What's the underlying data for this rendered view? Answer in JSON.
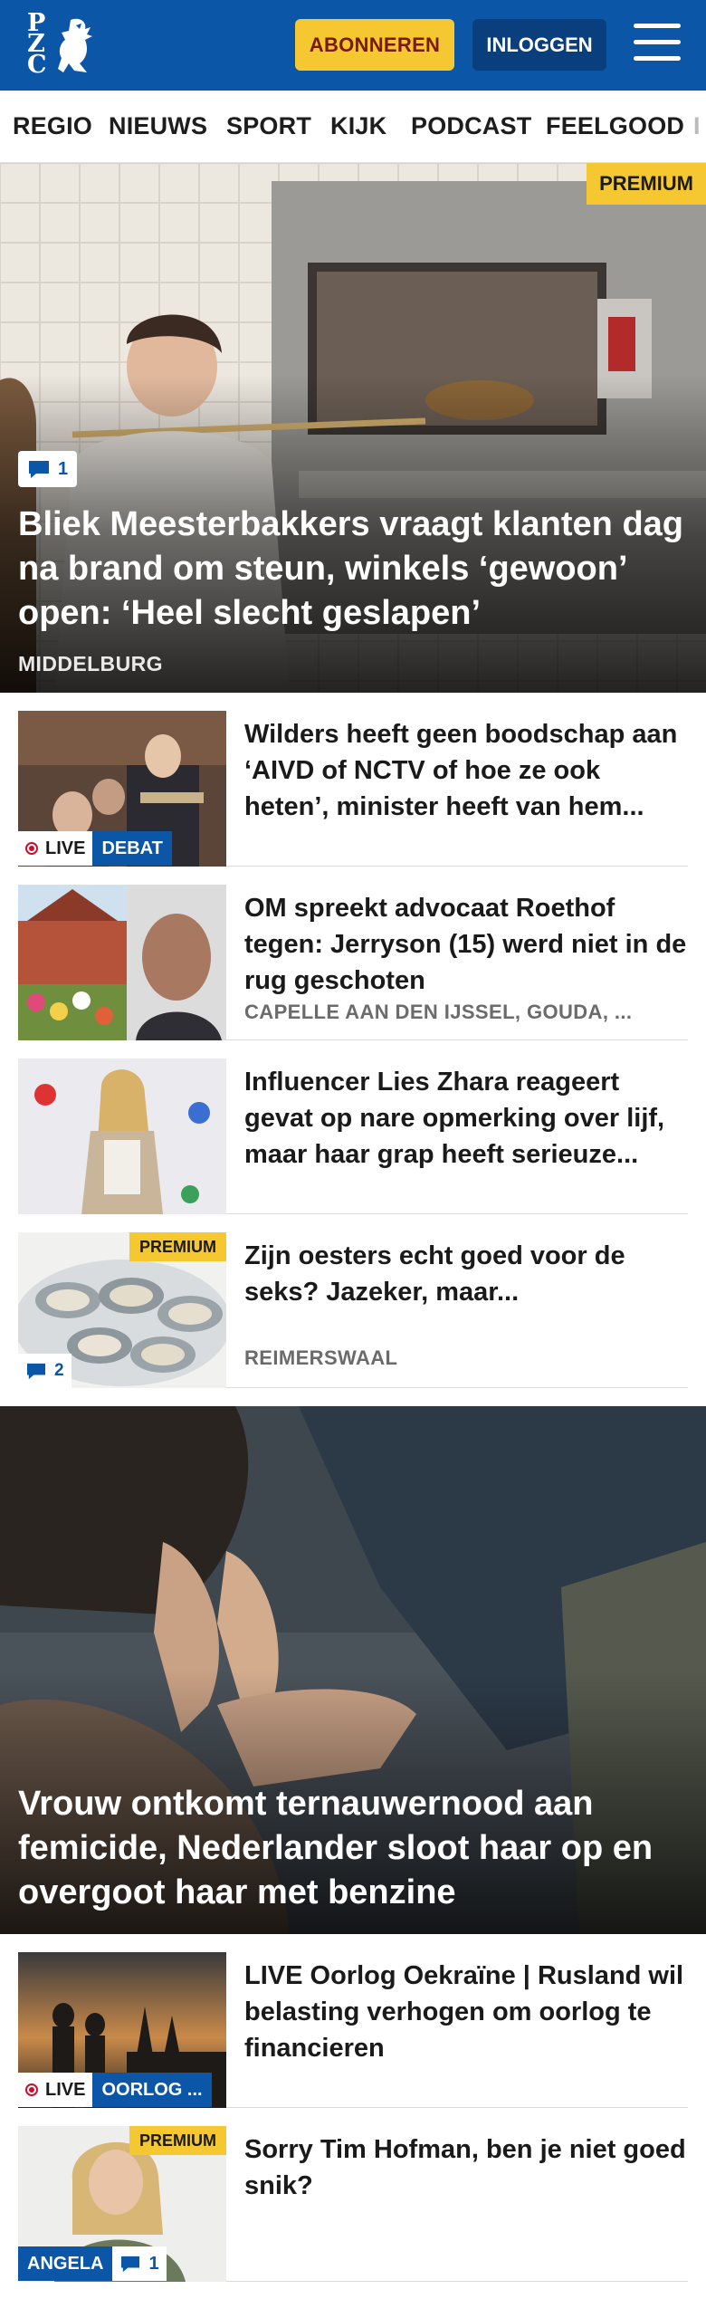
{
  "header": {
    "logo_letters": "PZC",
    "subscribe_label": "ABONNEREN",
    "login_label": "INLOGGEN",
    "menu_icon": "hamburger-menu-icon"
  },
  "nav": {
    "items": [
      "REGIO",
      "NIEUWS",
      "SPORT",
      "KIJK",
      "PODCAST",
      "FEELGOOD",
      "I"
    ]
  },
  "hero": {
    "badge": "PREMIUM",
    "comments": "1",
    "title": "Bliek Meesterbakkers vraagt klanten dag na brand om steun, winkels ‘gewoon’ open: ‘Heel slecht geslapen’",
    "place": "MIDDELBURG"
  },
  "articles": [
    {
      "title": "Wilders heeft geen boodschap aan ‘AIVD of NCTV of hoe ze ook heten’, minister heeft van hem...",
      "live_label": "LIVE",
      "tag": "DEBAT"
    },
    {
      "title": "OM spreekt advocaat Roethof tegen: Jerryson (15) werd niet in de rug geschoten",
      "place": "CAPELLE AAN DEN IJSSEL, GOUDA, ..."
    },
    {
      "title": "Influencer Lies Zhara reageert gevat op nare opmerking over lijf, maar haar grap heeft serieuze..."
    },
    {
      "title": "Zijn oesters echt goed voor de seks? Jazeker, maar...",
      "badge": "PREMIUM",
      "comments": "2",
      "place": "REIMERSWAAL"
    }
  ],
  "hero2": {
    "title": "Vrouw ontkomt ternauwernood aan femicide, Nederlander sloot haar op en overgoot haar met benzine"
  },
  "articles2": [
    {
      "title": "LIVE Oorlog Oekraïne | Rusland wil belasting verhogen om oorlog te financieren",
      "live_label": "LIVE",
      "tag": "OORLOG ..."
    },
    {
      "title": "Sorry Tim Hofman, ben je niet goed snik?",
      "badge": "PREMIUM",
      "tag": "ANGELA",
      "comments": "1"
    }
  ],
  "colors": {
    "brand_blue": "#0b56a6",
    "premium_yellow": "#f5c731",
    "live_red": "#c8102e"
  }
}
